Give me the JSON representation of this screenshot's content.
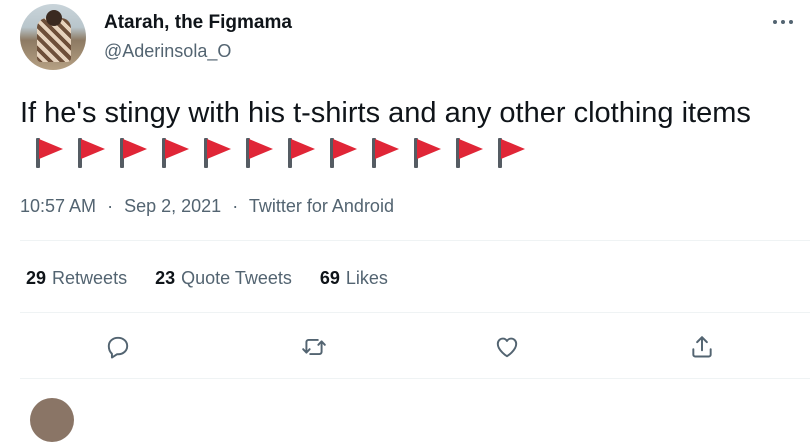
{
  "author": {
    "name": "Atarah, the Figmama",
    "handle": "@Aderinsola_O",
    "avatar_icon": "profile-photo"
  },
  "tweet": {
    "text": "If he's stingy with his t-shirts and any other clothing items",
    "emoji": "red-flag",
    "emoji_count": 12,
    "time": "10:57 AM",
    "date": "Sep 2, 2021",
    "separator": "·",
    "source": "Twitter for Android"
  },
  "stats": {
    "retweets": {
      "count": "29",
      "label": "Retweets"
    },
    "quote_tweets": {
      "count": "23",
      "label": "Quote Tweets"
    },
    "likes": {
      "count": "69",
      "label": "Likes"
    }
  },
  "actions": [
    "reply-icon",
    "retweet-icon",
    "like-icon",
    "share-icon"
  ],
  "colors": {
    "text": "#0f1419",
    "muted": "#536471",
    "divider": "#eff3f4",
    "flag": "#e02637"
  }
}
